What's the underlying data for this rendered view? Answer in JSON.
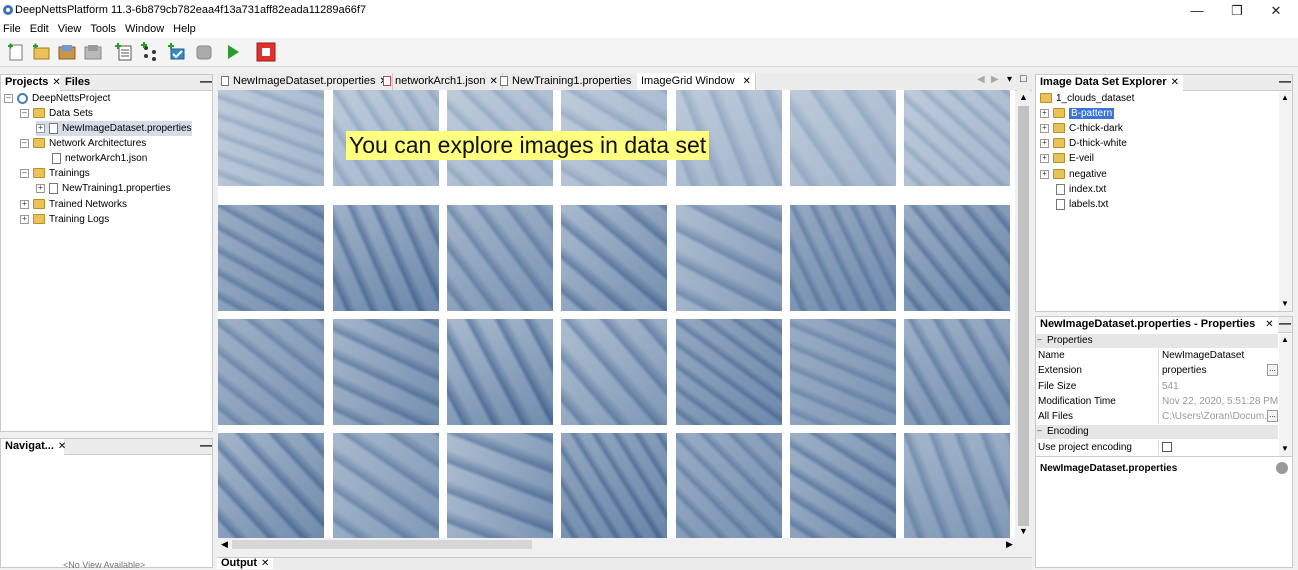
{
  "window": {
    "title": "DeepNettsPlatform 11.3-6b879cb782eaa4f13a731aff82eada11289a66f7"
  },
  "menu": [
    "File",
    "Edit",
    "View",
    "Tools",
    "Window",
    "Help"
  ],
  "projects_panel": {
    "tabs": [
      "Projects",
      "Files"
    ],
    "tree": {
      "root": "DeepNettsProject",
      "data_sets": "Data Sets",
      "dataset_file": "NewImageDataset.properties",
      "network_architectures": "Network Architectures",
      "network_file": "networkArch1.json",
      "trainings": "Trainings",
      "training_file": "NewTraining1.properties",
      "trained_networks": "Trained Networks",
      "training_logs": "Training Logs"
    }
  },
  "navigator_panel": {
    "tab": "Navigat...",
    "empty_text": "<No View Available>"
  },
  "editor_tabs": [
    "NewImageDataset.properties",
    "networkArch1.json",
    "NewTraining1.properties",
    "ImageGrid Window"
  ],
  "caption": "You can explore images in data set",
  "explorer": {
    "tab": "Image Data Set Explorer",
    "root": "1_clouds_dataset",
    "items": [
      "B-pattern",
      "C-thick-dark",
      "D-thick-white",
      "E-veil",
      "negative"
    ],
    "files": [
      "index.txt",
      "labels.txt"
    ]
  },
  "properties": {
    "tab": "NewImageDataset.properties - Properties",
    "section_properties": "Properties",
    "name_label": "Name",
    "name_value": "NewImageDataset",
    "extension_label": "Extension",
    "extension_value": "properties",
    "filesize_label": "File Size",
    "filesize_value": "541",
    "modtime_label": "Modification Time",
    "modtime_value": "Nov 22, 2020, 5:51:28 PM",
    "allfiles_label": "All Files",
    "allfiles_value": "C:\\Users\\Zoran\\Docum...",
    "section_encoding": "Encoding",
    "encoding_label": "Use project encoding",
    "footer": "NewImageDataset.properties"
  },
  "output_tab": "Output",
  "colors": {
    "accent_selection": "#3875d7",
    "caption_bg": "#ffff80",
    "stop_red": "#e03030",
    "run_green": "#2e9a2e"
  }
}
